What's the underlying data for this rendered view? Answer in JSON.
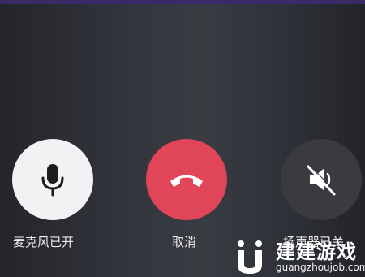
{
  "controls": {
    "mic": {
      "label": "麦克风已开",
      "icon": "microphone-icon",
      "state": "on",
      "color": "#f2f1f3"
    },
    "cancel": {
      "label": "取消",
      "icon": "hang-up-phone-icon",
      "color": "#e04558"
    },
    "speaker": {
      "label": "扬声器已关",
      "icon": "speaker-muted-icon",
      "state": "off",
      "color": "#3a3b41"
    }
  },
  "watermark": {
    "title": "建建游戏",
    "site": "guangzhoujob.com"
  }
}
